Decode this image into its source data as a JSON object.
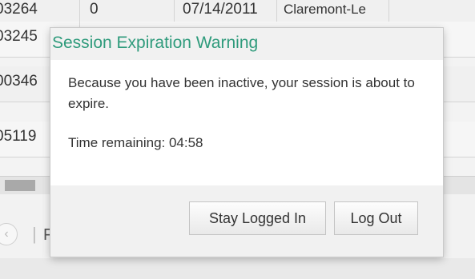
{
  "background": {
    "rows": [
      {
        "id": "03264",
        "num": "0",
        "date": "07/14/2011",
        "city": "Claremont-Le"
      },
      {
        "id": "03245",
        "num": "",
        "date": "",
        "city": ""
      },
      {
        "id": "00346",
        "num": "",
        "date": "",
        "city": ""
      },
      {
        "id": "05119",
        "num": "",
        "date": "",
        "city": ""
      }
    ],
    "pager": {
      "prev_glyph": "‹",
      "separator": "|",
      "text": "F"
    }
  },
  "dialog": {
    "title": "Session Expiration Warning",
    "message": "Because you have been inactive, your session is about to expire.",
    "time_remaining": "Time remaining: 04:58",
    "buttons": {
      "stay": "Stay Logged In",
      "logout": "Log Out"
    }
  },
  "colors": {
    "title_accent": "#2f9b7c"
  }
}
